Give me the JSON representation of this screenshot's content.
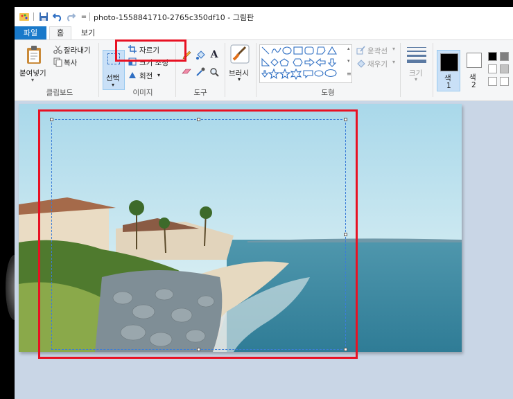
{
  "window": {
    "title": "photo-1558841710-2765c350df10 - 그림판"
  },
  "quick_access": {
    "dropdown_glyph": "="
  },
  "tabs": [
    {
      "label": "파일"
    },
    {
      "label": "홈"
    },
    {
      "label": "보기"
    }
  ],
  "clipboard": {
    "paste_label": "붙여넣기",
    "cut_label": "잘라내기",
    "copy_label": "복사",
    "group_label": "클립보드"
  },
  "image": {
    "select_label": "선택",
    "crop_label": "자르기",
    "resize_label": "크기 조정",
    "rotate_label": "회전",
    "group_label": "이미지"
  },
  "tools": {
    "group_label": "도구",
    "text_tool_glyph": "A"
  },
  "brushes": {
    "label": "브러시"
  },
  "shapes": {
    "outline_label": "윤곽선",
    "fill_label": "채우기",
    "group_label": "도형"
  },
  "size": {
    "label": "크기"
  },
  "colors": {
    "color1_label": "색",
    "color1_num": "1",
    "color2_label": "색",
    "color2_num": "2",
    "accent": "#1979ca",
    "highlight": "#e81123"
  }
}
